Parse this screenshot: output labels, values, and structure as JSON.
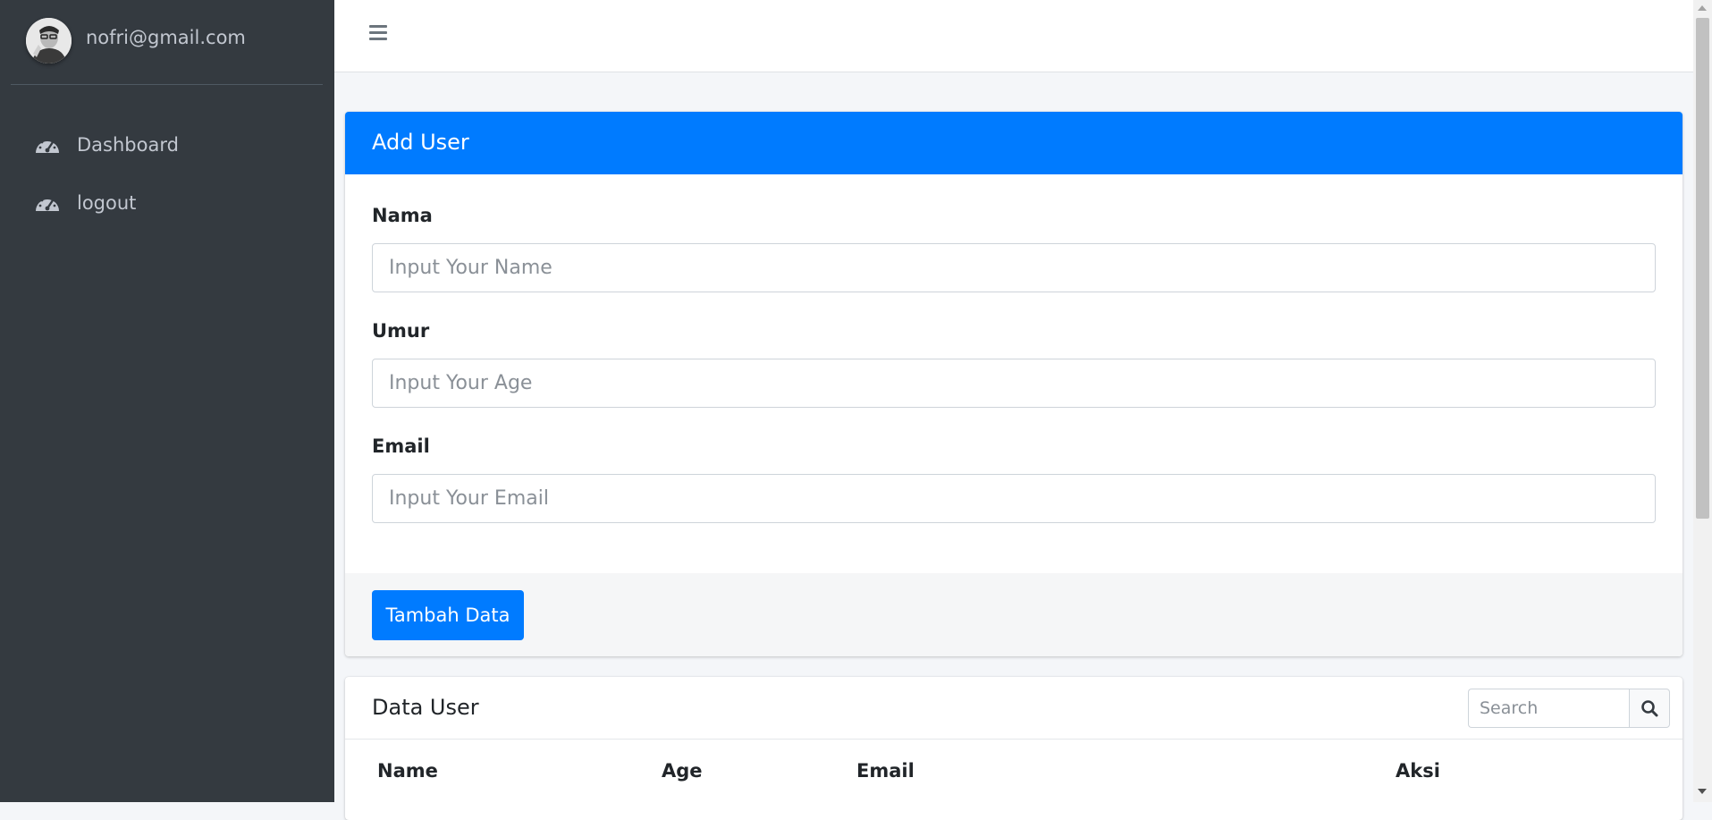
{
  "sidebar": {
    "user_email": "nofri@gmail.com",
    "items": [
      {
        "label": "Dashboard",
        "icon": "tachometer-icon"
      },
      {
        "label": "logout",
        "icon": "tachometer-icon"
      }
    ]
  },
  "topbar": {
    "menu_icon": "hamburger-icon"
  },
  "add_user": {
    "title": "Add User",
    "fields": [
      {
        "label": "Nama",
        "placeholder": "Input Your Name",
        "value": ""
      },
      {
        "label": "Umur",
        "placeholder": "Input Your Age",
        "value": ""
      },
      {
        "label": "Email",
        "placeholder": "Input Your Email",
        "value": ""
      }
    ],
    "submit_label": "Tambah Data"
  },
  "data_user": {
    "title": "Data User",
    "search_placeholder": "Search",
    "columns": [
      "Name",
      "Age",
      "Email",
      "Aksi"
    ]
  },
  "colors": {
    "primary": "#007bff",
    "sidebar": "#343a40",
    "page_bg": "#f4f6f9"
  }
}
